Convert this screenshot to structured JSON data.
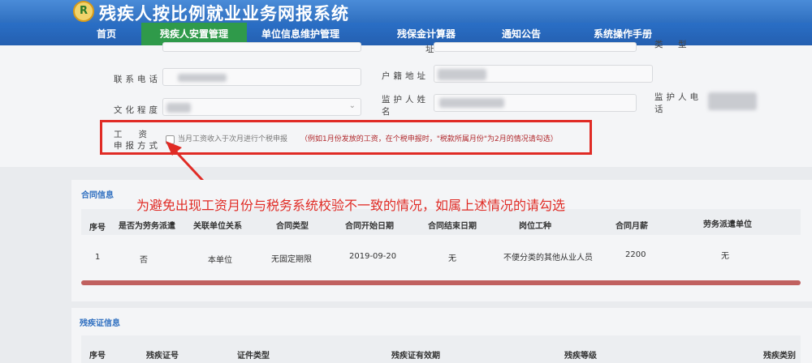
{
  "header": {
    "site_title": "残疾人按比例就业业务网报系统",
    "logo_char": "R"
  },
  "nav": {
    "items": [
      {
        "label": "首页"
      },
      {
        "label": "残疾人安置管理"
      },
      {
        "label": "单位信息维护管理"
      },
      {
        "label": "残保金计算器"
      },
      {
        "label": "通知公告"
      },
      {
        "label": "系统操作手册"
      }
    ]
  },
  "form": {
    "cut_label_left": "址",
    "cut_label_type": "类　型",
    "phone_label": "联系电话",
    "address_label": "户籍地址",
    "education_label": "文化程度",
    "guardian_name_label": "监护人姓名",
    "guardian_phone_label": "监护人电话",
    "wage_label_line1": "工资",
    "wage_label_line2": "申报方式",
    "wage_checkbox_label": "当月工资收入于次月进行个税申报",
    "wage_checkbox_note": "（例如1月份发放的工资，在个税申报时，\"税款所属月份\"为2月的情况请勾选）"
  },
  "annotation": {
    "text": "为避免出现工资月份与税务系统校验不一致的情况，如属上述情况的请勾选"
  },
  "contract": {
    "title": "合同信息",
    "columns": [
      "序号",
      "是否为劳务派遣",
      "关联单位关系",
      "合同类型",
      "合同开始日期",
      "合同结束日期",
      "岗位工种",
      "合同月薪",
      "劳务派遣单位"
    ],
    "rows": [
      {
        "no": "1",
        "dispatch": "否",
        "relation": "本单位",
        "type": "无固定期限",
        "start": "2019-09-20",
        "end": "无",
        "job": "不便分类的其他从业人员",
        "salary": "2200",
        "dispatch_unit": "无"
      }
    ]
  },
  "disability": {
    "title": "残疾证信息",
    "columns": [
      "序号",
      "残疾证号",
      "证件类型",
      "残疾证有效期",
      "残疾等级",
      "残疾类别"
    ]
  },
  "colors": {
    "nav_blue": "#2a6fc6",
    "nav_active_green": "#2f9a4a",
    "annotation_red": "#e02b25",
    "note_red": "#b0262a",
    "section_title_blue": "#2f6fc0"
  }
}
